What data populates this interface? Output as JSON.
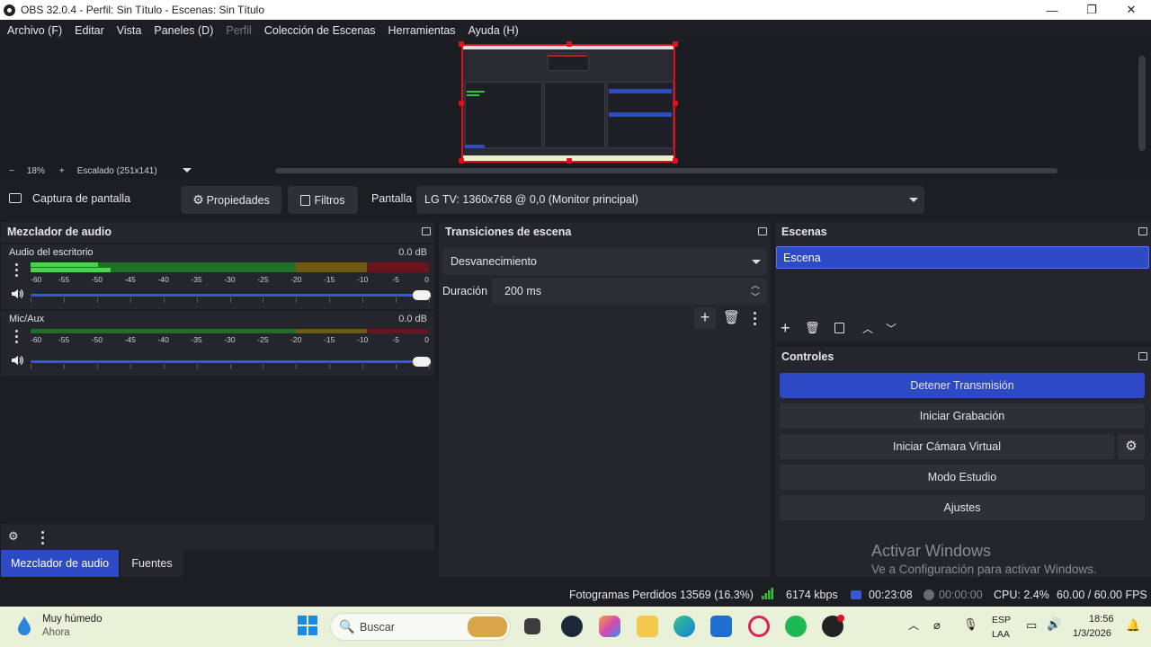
{
  "window": {
    "title": "OBS 32.0.4 - Perfil: Sin Título - Escenas: Sin Título",
    "minimize": "—",
    "maximize": "❐",
    "close": "✕"
  },
  "menu": [
    "Archivo (F)",
    "Editar",
    "Vista",
    "Paneles (D)",
    "Perfil",
    "Colección de Escenas",
    "Herramientas",
    "Ayuda (H)"
  ],
  "zoom": {
    "minus": "−",
    "percent": "18%",
    "plus": "+",
    "scaled": "Escalado (251x141)"
  },
  "source_toolbar": {
    "source_name": "Captura de pantalla",
    "properties": "Propiedades",
    "filters": "Filtros",
    "display_label": "Pantalla",
    "display_value": "LG TV: 1360x768 @ 0,0 (Monitor principal)"
  },
  "mixer": {
    "title": "Mezclador de audio",
    "channels": [
      {
        "name": "Audio del escritorio",
        "db": "0.0 dB",
        "level_fraction_top": 0.17,
        "level_fraction_bottom": 0.2,
        "volume_fraction": 1.0
      },
      {
        "name": "Mic/Aux",
        "db": "0.0 dB",
        "level_fraction_top": 0,
        "level_fraction_bottom": 0,
        "volume_fraction": 1.0
      }
    ],
    "ticks": [
      "-60",
      "-55",
      "-50",
      "-45",
      "-40",
      "-35",
      "-30",
      "-25",
      "-20",
      "-15",
      "-10",
      "-5",
      "0"
    ]
  },
  "bottom_tabs": {
    "mixer": "Mezclador de audio",
    "sources": "Fuentes"
  },
  "transitions": {
    "title": "Transiciones de escena",
    "selected": "Desvanecimiento",
    "duration_label": "Duración",
    "duration_value": "200 ms"
  },
  "scenes": {
    "title": "Escenas",
    "items": [
      "Escena"
    ]
  },
  "controls": {
    "title": "Controles",
    "stop_stream": "Detener Transmisión",
    "start_record": "Iniciar Grabación",
    "start_virtualcam": "Iniciar Cámara Virtual",
    "studio_mode": "Modo Estudio",
    "settings": "Ajustes"
  },
  "watermark": {
    "line1": "Activar Windows",
    "line2": "Ve a Configuración para activar Windows."
  },
  "status": {
    "dropped_frames": "Fotogramas Perdidos 13569 (16.3%)",
    "bitrate": "6174 kbps",
    "stream_time": "00:23:08",
    "record_time": "00:00:00",
    "cpu": "CPU: 2.4%",
    "fps": "60.00 / 60.00 FPS"
  },
  "taskbar": {
    "weather_line1": "Muy húmedo",
    "weather_line2": "Ahora",
    "search_placeholder": "Buscar",
    "lang1": "ESP",
    "lang2": "LAA",
    "time": "18:56",
    "date": "1/3/2026"
  },
  "colors": {
    "accent": "#2e49c5",
    "bg": "#1d1e24",
    "dock": "#25262d",
    "preview_border": "#e0101a"
  }
}
